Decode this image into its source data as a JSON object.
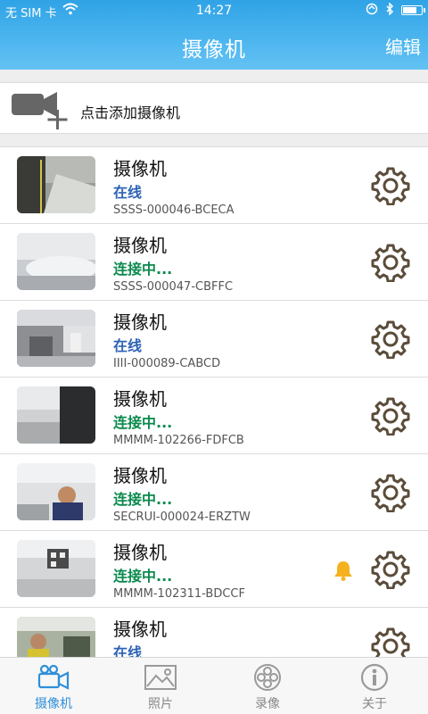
{
  "status_bar": {
    "carrier": "无 SIM 卡",
    "time": "14:27"
  },
  "header": {
    "title": "摄像机",
    "edit_label": "编辑"
  },
  "add_camera": {
    "label": "点击添加摄像机"
  },
  "cameras": [
    {
      "name": "摄像机",
      "status": "在线",
      "status_kind": "online",
      "serial": "SSSS-000046-BCECA",
      "alert": false
    },
    {
      "name": "摄像机",
      "status": "连接中...",
      "status_kind": "connecting",
      "serial": "SSSS-000047-CBFFC",
      "alert": false
    },
    {
      "name": "摄像机",
      "status": "在线",
      "status_kind": "online",
      "serial": "IIII-000089-CABCD",
      "alert": false
    },
    {
      "name": "摄像机",
      "status": "连接中...",
      "status_kind": "connecting",
      "serial": "MMMM-102266-FDFCB",
      "alert": false
    },
    {
      "name": "摄像机",
      "status": "连接中...",
      "status_kind": "connecting",
      "serial": "SECRUI-000024-ERZTW",
      "alert": false
    },
    {
      "name": "摄像机",
      "status": "连接中...",
      "status_kind": "connecting",
      "serial": "MMMM-102311-BDCCF",
      "alert": true
    },
    {
      "name": "摄像机",
      "status": "在线",
      "status_kind": "online",
      "serial": "",
      "alert": false
    }
  ],
  "tabs": [
    {
      "label": "摄像机",
      "icon": "camcorder-icon",
      "active": true
    },
    {
      "label": "照片",
      "icon": "photo-icon",
      "active": false
    },
    {
      "label": "录像",
      "icon": "film-reel-icon",
      "active": false
    },
    {
      "label": "关于",
      "icon": "info-icon",
      "active": false
    }
  ],
  "colors": {
    "header": "#3aaae9",
    "online": "#2d62b5",
    "connecting": "#0b8a4e",
    "tab_active": "#2f8fd8",
    "gear": "#5b4c3a",
    "bell": "#f5b21e"
  }
}
